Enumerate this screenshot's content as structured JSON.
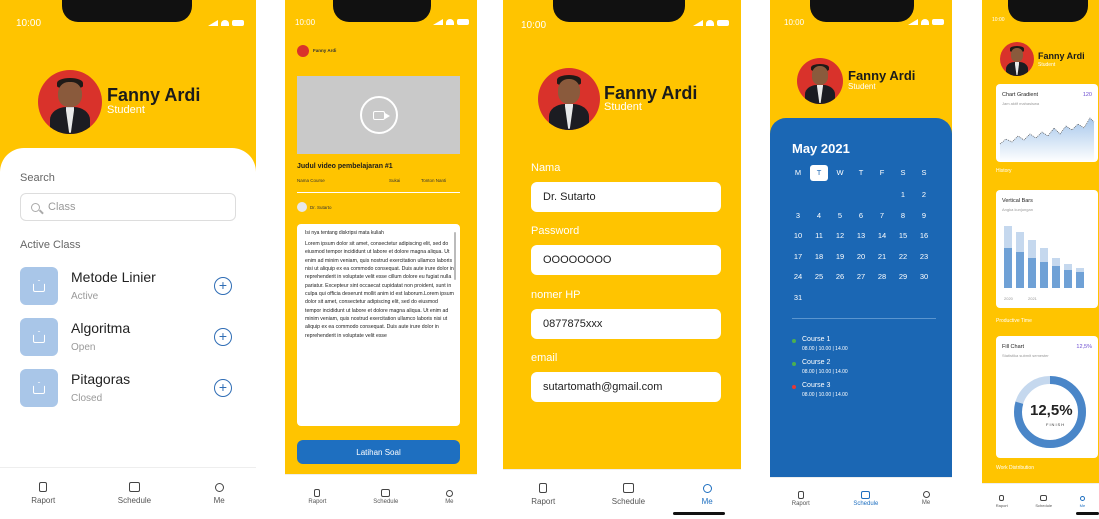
{
  "profile": {
    "name": "Fanny Ardi",
    "role": "Student"
  },
  "status_time": "10:00",
  "nav": {
    "raport": "Raport",
    "schedule": "Schedule",
    "me": "Me"
  },
  "phone1": {
    "search_label": "Search",
    "search_placeholder": "Class",
    "active_label": "Active Class",
    "classes": [
      {
        "title": "Metode Linier",
        "status": "Active"
      },
      {
        "title": "Algoritma",
        "status": "Open"
      },
      {
        "title": "Pitagoras",
        "status": "Closed"
      }
    ]
  },
  "phone2": {
    "video_title": "Judul video pembelajaran #1",
    "course_name": "Nama Course",
    "like_label": "Sukai",
    "add_label": "Tonton Nanti",
    "teacher": "Dr. Sutarto",
    "desc_head": "Isi nya tentang diskripsi mata kuliah",
    "desc_body": "Lorem ipsum dolor sit amet, consectetur adipiscing elit, sed do eiusmod tempor incididunt ut labore et dolore magna aliqua. Ut enim ad minim veniam, quis nostrud exercitation ullamco laboris nisi ut aliquip ex ea commodo consequat. Duis aute irure dolor in reprehenderit in voluptate velit esse cillum dolore eu fugiat nulla pariatur. Excepteur sint occaecat cupidatat non proident, sunt in culpa qui officia deserunt mollit anim id est laborum.Lorem ipsum dolor sit amet, consectetur adipiscing elit, sed do eiusmod tempor incididunt ut labore et dolore magna aliqua. Ut enim ad minim veniam, quis nostrud exercitation ullamco laboris nisi ut aliquip ex ea commodo consequat. Duis aute irure dolor in reprehenderit in voluptate velit esse",
    "cta": "Latihan Soal"
  },
  "phone3": {
    "fields": [
      {
        "label": "Nama",
        "value": "Dr. Sutarto"
      },
      {
        "label": "Password",
        "value": "OOOOOOOO"
      },
      {
        "label": "nomer HP",
        "value": "0877875xxx"
      },
      {
        "label": "email",
        "value": "sutartomath@gmail.com"
      }
    ]
  },
  "phone4": {
    "month": "May 2021",
    "weekdays": [
      "M",
      "T",
      "W",
      "T",
      "F",
      "S",
      "S"
    ],
    "selected_weekday_index": 1,
    "days": [
      "1",
      "2",
      "3",
      "4",
      "5",
      "6",
      "7",
      "8",
      "9",
      "10",
      "11",
      "12",
      "13",
      "14",
      "15",
      "16",
      "17",
      "18",
      "19",
      "20",
      "21",
      "22",
      "23",
      "24",
      "25",
      "26",
      "27",
      "28",
      "29",
      "30",
      "31"
    ],
    "first_day_col": 5,
    "courses": [
      {
        "name": "Course 1",
        "times": "08.00 | 10.00 | 14.00",
        "color": "#4caf50"
      },
      {
        "name": "Course 2",
        "times": "08.00 | 10.00 | 14.00",
        "color": "#4caf50"
      },
      {
        "name": "Course 3",
        "times": "08.00 | 10.00 | 14.00",
        "color": "#e53935"
      }
    ]
  },
  "phone5": {
    "card1_title": "Chart Gradient",
    "card1_sub": "Jam aktif mahasiswa",
    "card1_val": "120",
    "history": "History",
    "card2_title": "Vertical Bars",
    "card2_sub": "Angka kunjungan",
    "legend": [
      "2020",
      "2021"
    ],
    "productive": "Productive Time",
    "card3_title": "Fill Chart",
    "card3_sub": "Statistika submit semester",
    "card3_val": "12,5%",
    "donut_value": "12,5%",
    "donut_label": "FINISH",
    "work": "Work Distribution",
    "colors": {
      "yellow": "#FFC400",
      "blue": "#1e6fc0"
    }
  }
}
